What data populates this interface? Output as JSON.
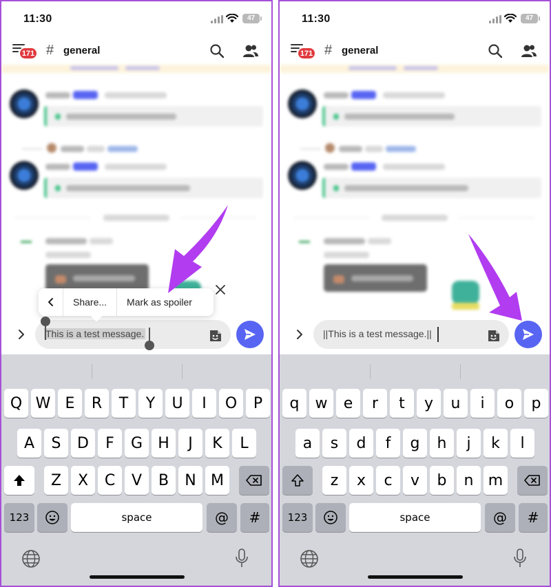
{
  "status_bar": {
    "time": "11:30",
    "battery": "47"
  },
  "header": {
    "badge_count": "171",
    "hash": "#",
    "channel": "general"
  },
  "left": {
    "context_menu": {
      "back": "<",
      "share": "Share...",
      "spoiler": "Mark as spoiler",
      "close": "×"
    },
    "input_text": "This is a test message."
  },
  "right": {
    "input_text": "||This is a test message.||"
  },
  "keyboard": {
    "upper_row1": [
      "Q",
      "W",
      "E",
      "R",
      "T",
      "Y",
      "U",
      "I",
      "O",
      "P"
    ],
    "upper_row2": [
      "A",
      "S",
      "D",
      "F",
      "G",
      "H",
      "J",
      "K",
      "L"
    ],
    "upper_row3": [
      "Z",
      "X",
      "C",
      "V",
      "B",
      "N",
      "M"
    ],
    "lower_row1": [
      "q",
      "w",
      "e",
      "r",
      "t",
      "y",
      "u",
      "i",
      "o",
      "p"
    ],
    "lower_row2": [
      "a",
      "s",
      "d",
      "f",
      "g",
      "h",
      "j",
      "k",
      "l"
    ],
    "lower_row3": [
      "z",
      "x",
      "c",
      "v",
      "b",
      "n",
      "m"
    ],
    "numbers_label": "123",
    "space_label": "space",
    "at_label": "@",
    "hash_label": "#"
  },
  "colors": {
    "frame": "#a64fd8",
    "accent": "#5865f2",
    "arrow": "#b13cf0",
    "badge": "#e03a3e"
  }
}
